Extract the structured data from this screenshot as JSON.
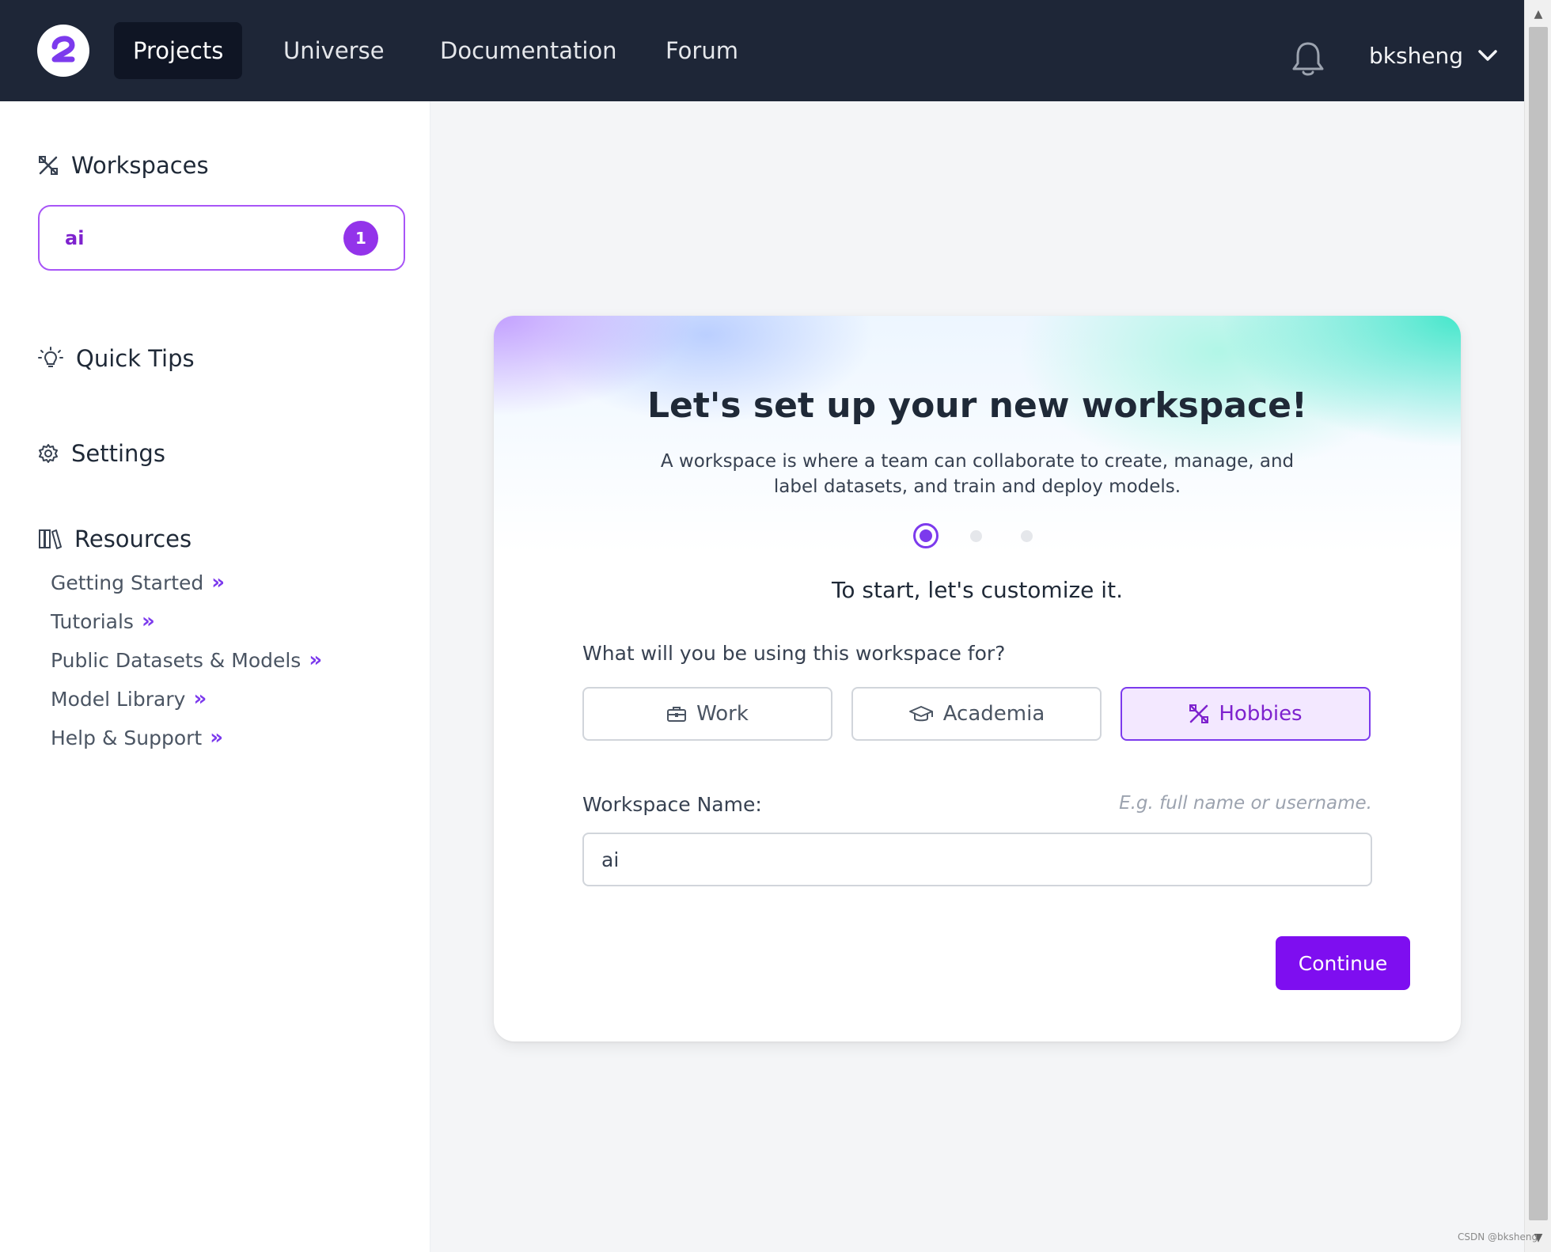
{
  "nav": {
    "logo_icon": "roboflow-logo-icon",
    "items": [
      {
        "label": "Projects",
        "active": true
      },
      {
        "label": "Universe",
        "active": false
      },
      {
        "label": "Documentation",
        "active": false
      },
      {
        "label": "Forum",
        "active": false
      }
    ],
    "bell_icon": "bell-icon",
    "username": "bksheng",
    "chevron_icon": "chevron-down-icon"
  },
  "sidebar": {
    "workspaces": {
      "heading": "Workspaces",
      "icon": "tools-icon"
    },
    "workspace_card": {
      "name": "ai",
      "badge": "1"
    },
    "quick_tips": {
      "heading": "Quick Tips",
      "icon": "lightbulb-icon"
    },
    "settings": {
      "heading": "Settings",
      "icon": "gear-icon"
    },
    "resources": {
      "heading": "Resources",
      "icon": "books-icon",
      "links": [
        {
          "label": "Getting Started",
          "chevron": "»"
        },
        {
          "label": "Tutorials",
          "chevron": "»"
        },
        {
          "label": "Public Datasets & Models",
          "chevron": "»"
        },
        {
          "label": "Model Library",
          "chevron": "»"
        },
        {
          "label": "Help & Support",
          "chevron": "»"
        }
      ]
    }
  },
  "card": {
    "title": "Let's set up your new workspace!",
    "description": "A workspace is where a team can collaborate to create, manage, and label datasets, and train and deploy models.",
    "steps": {
      "total": 3,
      "current": 1
    },
    "subtitle": "To start, let's customize it.",
    "question": "What will you be using this workspace for?",
    "options": [
      {
        "label": "Work",
        "icon": "briefcase-icon",
        "selected": false
      },
      {
        "label": "Academia",
        "icon": "graduation-cap-icon",
        "selected": false
      },
      {
        "label": "Hobbies",
        "icon": "tools-icon",
        "selected": true
      }
    ],
    "name_field": {
      "label": "Workspace Name:",
      "hint": "E.g. full name or username.",
      "value": "ai"
    },
    "continue_label": "Continue"
  },
  "colors": {
    "nav_bg": "#1e2637",
    "accent": "#7e0ef0",
    "selected_bg": "#f3e8ff"
  },
  "watermark": "CSDN @bksheng"
}
